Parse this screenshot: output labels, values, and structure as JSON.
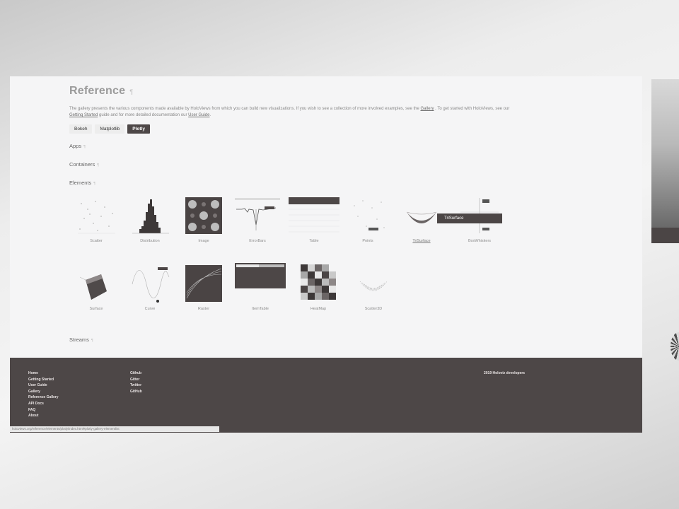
{
  "page": {
    "title": "Reference",
    "intro": {
      "prefix": "The gallery presents the various components made available by HoloViews from which you can build new visualizations. If you wish to see a collection of more involved examples, see the",
      "gallery_link": "Gallery",
      "middle": ". To get started with HoloViews, see our",
      "getting_started_link": "Getting Started",
      "middle2": "guide and for more detailed documentation our",
      "user_guide_link": "User Guide",
      "suffix": "."
    },
    "backend_tabs": [
      "Bokeh",
      "Matplotlib",
      "Plotly"
    ],
    "active_tab": "Plotly",
    "sections": {
      "apps": "Apps",
      "containers": "Containers",
      "elements": "Elements",
      "streams": "Streams"
    },
    "elements_row1": [
      "Scatter",
      "Distribution",
      "Image",
      "ErrorBars",
      "Table",
      "Points",
      "TriSurface",
      "BoxWhiskers"
    ],
    "elements_row2": [
      "Surface",
      "Curve",
      "Raster",
      "ItemTable",
      "HeatMap",
      "Scatter3D"
    ],
    "tooltip": "TriSurface"
  },
  "footer": {
    "col1": [
      "Home",
      "Getting Started",
      "User Guide",
      "Gallery",
      "Reference Gallery",
      "API Docs",
      "FAQ",
      "About"
    ],
    "col2": [
      "Github",
      "Gitter",
      "Twitter",
      "GitHub"
    ],
    "copyright": "2019 Holoviz developers"
  },
  "status_url": "holoviews.org/reference/elements/plotly/index.html#plotly-gallery-elementlist",
  "colors": {
    "footer_bg": "#4d4747",
    "active_tab": "#4d4747",
    "page_bg": "#f5f5f6"
  }
}
